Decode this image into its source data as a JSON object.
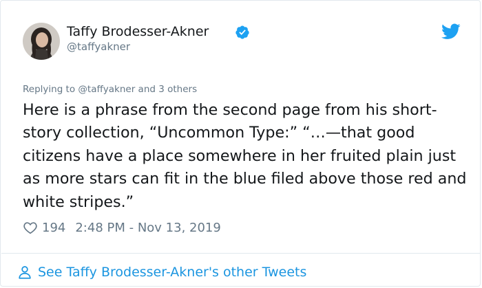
{
  "user": {
    "display_name": "Taffy Brodesser-Akner",
    "handle": "@taffyakner",
    "verified": true
  },
  "reply_context": {
    "prefix": "Replying to ",
    "mention": "@taffyakner",
    "suffix": " and 3 others"
  },
  "tweet": {
    "text": "Here is a phrase from the second page from his short-story collection, “Uncommon Type:” “…—that good citizens have a place somewhere in her fruited plain just as more stars can fit in the blue filed above those red and white stripes.”",
    "likes": "194",
    "timestamp": "2:48 PM - Nov 13, 2019"
  },
  "footer": {
    "link_text": "See Taffy Brodesser-Akner's other Tweets"
  },
  "colors": {
    "accent": "#1da1f2",
    "link": "#1b95e0",
    "muted": "#657786",
    "text": "#14171a",
    "border": "#e1e8ed"
  },
  "icons": [
    "avatar",
    "verified-badge-icon",
    "twitter-bird-icon",
    "heart-icon",
    "person-icon"
  ]
}
